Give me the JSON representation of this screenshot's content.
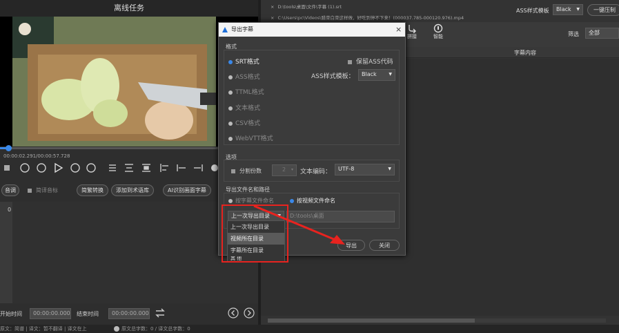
{
  "left_panel": {
    "title": "离线任务",
    "time": "00:00:02.291/00:00:57.728",
    "action_buttons": [
      "音调",
      "简译音标",
      "简繁转换",
      "添加到术语库",
      "AI识别画面字幕"
    ],
    "row_number": "0",
    "start_label": "开始时间",
    "start_value": "00:00:00.000",
    "end_label": "结束时间",
    "end_value": "00:00:00.000",
    "status": "原文：简谱 | 译文：暂不翻译 | 译文在上",
    "char_count": "原文总字数：0 / 译文总字数：0"
  },
  "right_panel": {
    "files": [
      "D:\\tools\\桌面\\文件\\字幕 (1).srt",
      "C:\\Users\\pc\\Videos\\腊菜白菜这样做，好吃到停不下来！(000037.785-000120.976).mp4"
    ],
    "style_label": "ASS样式模板",
    "style_value": "Black",
    "burn_button": "一键压制",
    "tool_labels": [
      "拼接",
      "智能"
    ],
    "filter_label": "筛选",
    "filter_value": "全部",
    "column_header": "字幕内容"
  },
  "dialog": {
    "title": "导出字幕",
    "close": "×",
    "format_section": "格式",
    "formats": [
      "SRT格式",
      "ASS格式",
      "TTML格式",
      "文本格式",
      "CSV格式",
      "WebVTT格式"
    ],
    "keep_ass_label": "保留ASS代码",
    "ass_template_label": "ASS样式模板：",
    "ass_template_value": "Black",
    "options_section": "选项",
    "split_label": "分割份数",
    "split_value": "2",
    "encoding_label": "文本编码：",
    "encoding_value": "UTF-8",
    "name_section": "导出文件名和路径",
    "name_option1": "按字幕文件命名",
    "name_option2": "按视频文件命名",
    "dir_selected": "上一次导出目录",
    "path_value": "D:\\tools\\桌面",
    "dropdown_options": [
      "上一次导出目录",
      "视频所在目录",
      "字幕所在目录"
    ],
    "hidden_option": "其 他",
    "export_button": "导出",
    "close_button": "关闭"
  }
}
